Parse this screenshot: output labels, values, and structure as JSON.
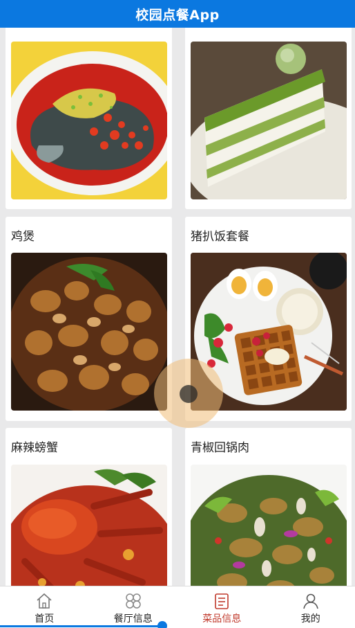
{
  "header": {
    "title": "校园点餐App"
  },
  "dishes": [
    {
      "name": ""
    },
    {
      "name": ""
    },
    {
      "name": "鸡煲"
    },
    {
      "name": "猪扒饭套餐"
    },
    {
      "name": "麻辣螃蟹"
    },
    {
      "name": "青椒回锅肉"
    }
  ],
  "tabbar": {
    "items": [
      {
        "label": "首页",
        "icon": "home-icon"
      },
      {
        "label": "餐厅信息",
        "icon": "grid-icon"
      },
      {
        "label": "菜品信息",
        "icon": "menu-list-icon",
        "active": true
      },
      {
        "label": "我的",
        "icon": "user-icon"
      }
    ]
  },
  "colors": {
    "primary": "#0b78e0",
    "active_tab": "#c0392b",
    "background": "#e9e9ea"
  }
}
